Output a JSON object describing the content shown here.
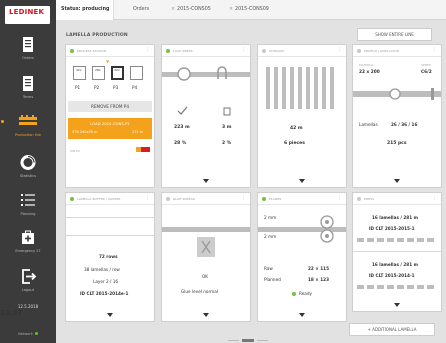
{
  "brand": {
    "wordmark": "LEDINEK",
    "subtitle": "",
    "accent": "#f4a21c",
    "danger": "#d81e1e",
    "ok": "#76c043"
  },
  "sidebar": {
    "items": [
      {
        "label": "Orders",
        "icon": "list-icon"
      },
      {
        "label": "Terms",
        "icon": "notebook-icon"
      },
      {
        "label": "Production line",
        "icon": "production-line-icon"
      },
      {
        "label": "Statistics",
        "icon": "donut-chart-icon"
      },
      {
        "label": "Planning",
        "icon": "checklist-icon"
      },
      {
        "label": "Emergency 27",
        "icon": "first-aid-icon"
      },
      {
        "label": "Logout",
        "icon": "logout-icon"
      }
    ],
    "date": "12.5.2018",
    "time": "13:37",
    "network": "Network"
  },
  "topbar": {
    "tabs": [
      "Status: producing",
      "Orders",
      "2015-CONS05",
      "2015-CONS09"
    ]
  },
  "content": {
    "title": "LAMELLA PRODUCTION",
    "show_line_btn": "SHOW ENTIRE LINE",
    "add_lamella_btn": "ADDITIONAL LAMELLA"
  },
  "cards": {
    "c1": {
      "title": "PROCESS STATION",
      "slots": [
        {
          "label": "P1",
          "top": "32x"
        },
        {
          "label": "P2",
          "top": "28x"
        },
        {
          "label": "P3",
          "top": "32x"
        },
        {
          "label": "P4",
          "top": ""
        }
      ],
      "remove_label": "REMOVE FROM P4",
      "orange_l1": "LOAD 2015-CONS-P1",
      "orange_l2_left": "376  240x35 m",
      "orange_l2_right": "231 m",
      "footer": "MM 02"
    },
    "c2": {
      "title": "LOAD PRESS",
      "v1": "223 m",
      "v2": "3 m",
      "v3": "28 %",
      "v4": "2 %"
    },
    "c3": {
      "title": "STORAGE",
      "v1": "42 m",
      "v2": "6 pieces"
    },
    "c4": {
      "title": "PROFILE LAMELLATOR",
      "top_left_label": "MATERIAL",
      "top_right_label": "SPEED",
      "top_left_value": "22 x 200",
      "top_right_value": "C6/2",
      "lamellas_label": "Lamellas",
      "lamellas_value": "26 / 36 / 16",
      "total": "215 pcs"
    },
    "c5": {
      "title": "LAMELLA BUFFER / SORTER",
      "v1": "72 rows",
      "v2": "38 lamellas / row",
      "v3": "Layer 2 / 16",
      "v4": "ID CLT 2015-2014e-1"
    },
    "c6": {
      "title": "GLUE SPREAD",
      "v1": "OK",
      "v2": "Glue level normal"
    },
    "c7": {
      "title": "PLANER",
      "a": "2 mm",
      "b": "2 mm",
      "row1_l": "Raw",
      "row1_v": "22 × 115",
      "row2_l": "Planned",
      "row2_v": "18 × 123",
      "status": "Ready"
    },
    "c8": {
      "title": "PRESS",
      "a1": "16 lamellas / 281 m",
      "a2": "ID CLT 2015-2015-1",
      "b1": "16 lamellas / 281 m",
      "b2": "ID CLT 2015-2014-1"
    }
  }
}
